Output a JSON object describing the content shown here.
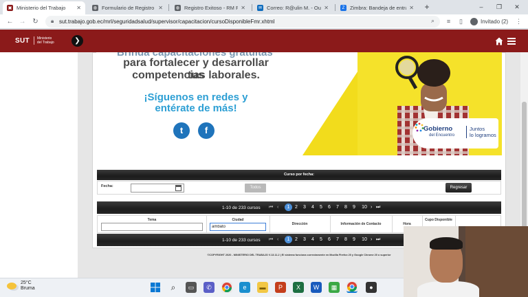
{
  "browser": {
    "tabs": [
      {
        "label": "Ministerio del Trabajo",
        "active": true,
        "favicon_color": "#8b1a1a"
      },
      {
        "label": "Formulario de Registro Bi",
        "active": false,
        "favicon_color": "#5f6368"
      },
      {
        "label": "Registro Exitoso - RM Pro",
        "active": false,
        "favicon_color": "#5f6368"
      },
      {
        "label": "Correo: R@ulin M. - Outl",
        "active": false,
        "favicon_color": "#0f6cbd"
      },
      {
        "label": "Zimbra: Bandeja de entra",
        "active": false,
        "favicon_color": "#1a73e8"
      }
    ],
    "url": "sut.trabajo.gob.ec/mrl/seguridadsalud/supervisor/capacitacion/cursoDisponibleFmr.xhtml",
    "profile_label": "Invitado (2)"
  },
  "site": {
    "logo_text": "SUT",
    "logo_subtitle_1": "Ministerio",
    "logo_subtitle_2": "del Trabajo",
    "brand_color": "#8b1a1a"
  },
  "banner": {
    "line1": "Brinda capacitaciones gratuitas",
    "line2": "para fortalecer y desarrollar tus",
    "line3": "competencias laborales.",
    "line4": "¡Síguenos en redes y",
    "line5": "entérate de más!",
    "gob_title": "Gobierno",
    "gob_sub": "del Encuentro",
    "gob_slogan_1": "Juntos",
    "gob_slogan_2": "lo logramos"
  },
  "filter": {
    "header": "Curso por fecha:",
    "date_label": "Fecha:",
    "date_value": "",
    "todos_label": "Todos",
    "regresar_label": "Regresar"
  },
  "pagination": {
    "count_text": "1-10 de 233 cursos",
    "current_page": "1",
    "pages": [
      "1",
      "2",
      "3",
      "4",
      "5",
      "6",
      "7",
      "8",
      "9",
      "10"
    ]
  },
  "table": {
    "headers": [
      "Tema",
      "Ciudad",
      "Dirección",
      "Información de Contacto",
      "Hora",
      "Cupo Disponible"
    ],
    "tema_value": "",
    "ciudad_value": "ambato"
  },
  "footer": {
    "text": "©COPYRIGHT 2020 - MINISTERIO DEL TRABAJO V.13.11.2 | El sistema funciona correctamente en Mozilla Firefox 20 y Google Chrome 20 o superior"
  },
  "taskbar": {
    "temperature": "25°C",
    "weather_label": "Bruma"
  }
}
